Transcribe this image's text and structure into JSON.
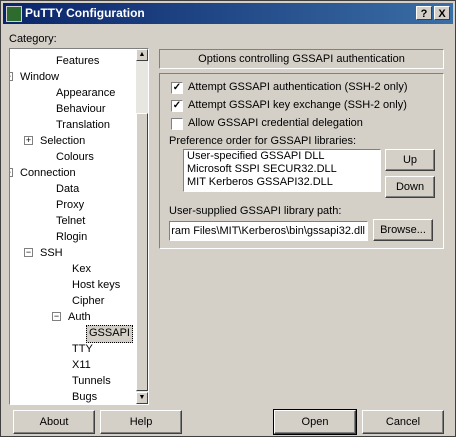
{
  "window": {
    "title": "PuTTY Configuration",
    "help_btn": "?",
    "close_btn": "X"
  },
  "category_label": "Category:",
  "tree": [
    {
      "label": "Features",
      "level": 2,
      "expander": ""
    },
    {
      "label": "Window",
      "level": 0,
      "expander": "−"
    },
    {
      "label": "Appearance",
      "level": 2,
      "expander": ""
    },
    {
      "label": "Behaviour",
      "level": 2,
      "expander": ""
    },
    {
      "label": "Translation",
      "level": 2,
      "expander": ""
    },
    {
      "label": "Selection",
      "level": 1,
      "expander": "+"
    },
    {
      "label": "Colours",
      "level": 2,
      "expander": ""
    },
    {
      "label": "Connection",
      "level": 0,
      "expander": "−"
    },
    {
      "label": "Data",
      "level": 2,
      "expander": ""
    },
    {
      "label": "Proxy",
      "level": 2,
      "expander": ""
    },
    {
      "label": "Telnet",
      "level": 2,
      "expander": ""
    },
    {
      "label": "Rlogin",
      "level": 2,
      "expander": ""
    },
    {
      "label": "SSH",
      "level": 1,
      "expander": "−"
    },
    {
      "label": "Kex",
      "level": 3,
      "expander": ""
    },
    {
      "label": "Host keys",
      "level": 3,
      "expander": ""
    },
    {
      "label": "Cipher",
      "level": 3,
      "expander": ""
    },
    {
      "label": "Auth",
      "level": 2,
      "expander": "−",
      "offset": 1
    },
    {
      "label": "GSSAPI",
      "level": 4,
      "expander": "",
      "selected": true
    },
    {
      "label": "TTY",
      "level": 3,
      "expander": ""
    },
    {
      "label": "X11",
      "level": 3,
      "expander": ""
    },
    {
      "label": "Tunnels",
      "level": 3,
      "expander": ""
    },
    {
      "label": "Bugs",
      "level": 3,
      "expander": ""
    }
  ],
  "panel": {
    "header": "Options controlling GSSAPI authentication",
    "checkboxes": [
      {
        "label": "Attempt GSSAPI authentication (SSH-2 only)",
        "checked": "✓"
      },
      {
        "label": "Attempt GSSAPI key exchange (SSH-2 only)",
        "checked": "✓"
      },
      {
        "label": "Allow GSSAPI credential delegation",
        "checked": ""
      }
    ],
    "pref_label": "Preference order for GSSAPI libraries:",
    "libraries": [
      "User-specified GSSAPI DLL",
      "Microsoft SSPI SECUR32.DLL",
      "MIT Kerberos GSSAPI32.DLL"
    ],
    "up_label": "Up",
    "down_label": "Down",
    "path_label": "User-supplied GSSAPI library path:",
    "path_value": "ram Files\\MIT\\Kerberos\\bin\\gssapi32.dll",
    "browse_label": "Browse..."
  },
  "footer": {
    "about": "About",
    "help": "Help",
    "open": "Open",
    "cancel": "Cancel"
  }
}
